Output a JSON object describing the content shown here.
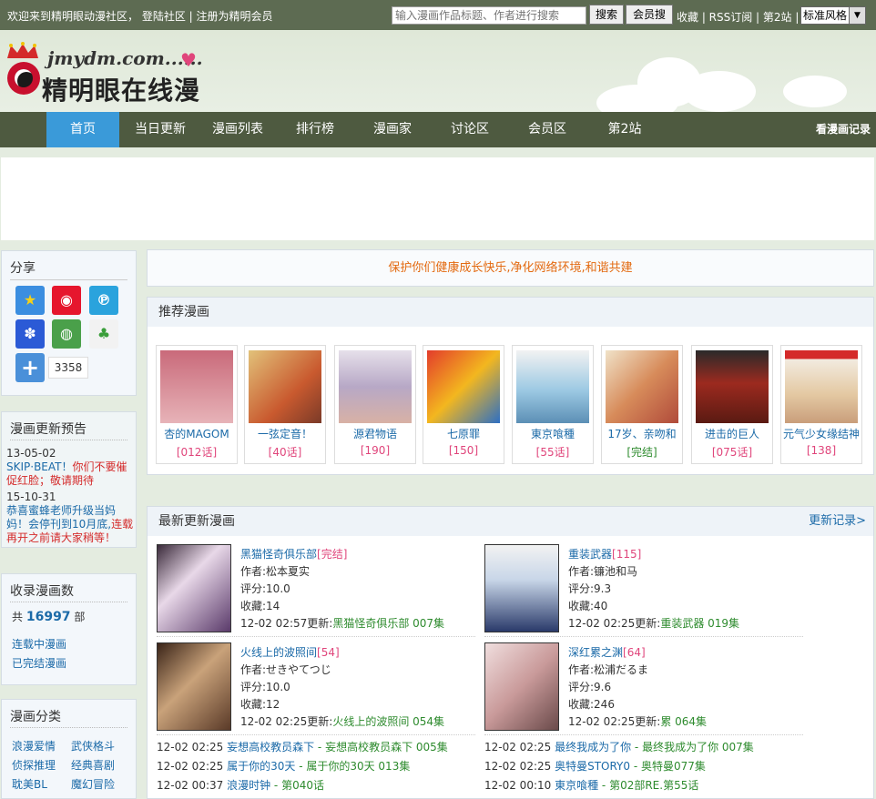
{
  "topbar": {
    "welcome": "欢迎来到精明眼动漫社区， 登陆社区 | 注册为精明会员",
    "search_placeholder": "输入漫画作品标题、作者进行搜索",
    "search_button": "搜索",
    "member_button": "会员搜",
    "links": "收藏 | RSS订阅 | 第2站 |",
    "style_select": "标准风格"
  },
  "logo": {
    "url": "jmydm.com......",
    "name": "精明眼在线漫画"
  },
  "nav": {
    "items": [
      "首页",
      "当日更新",
      "漫画列表",
      "排行榜",
      "漫画家",
      "讨论区",
      "会员区",
      "第2站"
    ],
    "history": "看漫画记录"
  },
  "sidebar": {
    "share": {
      "title": "分享",
      "count": "3358"
    },
    "preview": {
      "title": "漫画更新预告",
      "entries": [
        {
          "date": "13-05-02",
          "name": "SKIP·BEAT！",
          "text": "你们不要催促红脸；敬请期待"
        },
        {
          "date": "15-10-31",
          "name": "恭喜蜜蜂老师升级当妈妈！会停刊到10月底,",
          "text": "连载再开之前请大家稍等！"
        }
      ]
    },
    "stats": {
      "title": "收录漫画数",
      "prefix": "共",
      "count": "16997",
      "suffix": "部",
      "ongoing": "连载中漫画",
      "completed": "已完结漫画"
    },
    "categories": {
      "title": "漫画分类",
      "items": [
        "浪漫爱情",
        "武侠格斗",
        "侦探推理",
        "经典喜剧",
        "耽美BL",
        "魔幻冒险"
      ]
    }
  },
  "notice": "保护你们健康成长快乐,净化网络环境,和谐共建",
  "recommend": {
    "title": "推荐漫画",
    "items": [
      {
        "name": "杏的MAGOM",
        "ep": "[012话]"
      },
      {
        "name": "一弦定音！",
        "ep": "[40话]"
      },
      {
        "name": "源君物语",
        "ep": "[190]"
      },
      {
        "name": "七原罪",
        "ep": "[150]"
      },
      {
        "name": "東京喰種",
        "ep": "[55话]"
      },
      {
        "name": "17岁、亲吻和",
        "ep": "[完结]"
      },
      {
        "name": "进击的巨人",
        "ep": "[075话]"
      },
      {
        "name": "元气少女缘结神",
        "ep": "[138]"
      }
    ]
  },
  "latest": {
    "title": "最新更新漫画",
    "more": "更新记录>",
    "featured": [
      {
        "title": "黑猫怪奇俱乐部",
        "tag": "[完结]",
        "author": "作者:松本夏实",
        "score": "评分:10.0",
        "fav": "收藏:14",
        "update": "12-02 02:57更新:",
        "ep": "黑猫怪奇俱乐部 007集"
      },
      {
        "title": "重装武器",
        "tag": "[115]",
        "author": "作者:镰池和马",
        "score": "评分:9.3",
        "fav": "收藏:40",
        "update": "12-02 02:25更新:",
        "ep": "重装武器 019集"
      },
      {
        "title": "火线上的波照间",
        "tag": "[54]",
        "author": "作者:せきやてつじ",
        "score": "评分:10.0",
        "fav": "收藏:12",
        "update": "12-02 02:25更新:",
        "ep": "火线上的波照间 054集"
      },
      {
        "title": "深红累之渊",
        "tag": "[64]",
        "author": "作者:松浦だるま",
        "score": "评分:9.6",
        "fav": "收藏:246",
        "update": "12-02 02:25更新:",
        "ep": "累 064集"
      }
    ],
    "updates": [
      {
        "time": "12-02 02:25",
        "name": "妄想高校教员森下",
        "ep": " - 妄想高校教员森下 005集"
      },
      {
        "time": "12-02 02:25",
        "name": "最终我成为了你",
        "ep": " - 最终我成为了你 007集"
      },
      {
        "time": "12-02 02:25",
        "name": "属于你的30天",
        "ep": " - 属于你的30天 013集"
      },
      {
        "time": "12-02 02:25",
        "name": "奥特曼STORY0",
        "ep": " - 奥特曼077集"
      },
      {
        "time": "12-02 00:37",
        "name": "浪漫时钟",
        "ep": " - 第040话"
      },
      {
        "time": "12-02 00:10",
        "name": "東京喰種",
        "ep": " - 第02部RE.第55话"
      }
    ]
  }
}
